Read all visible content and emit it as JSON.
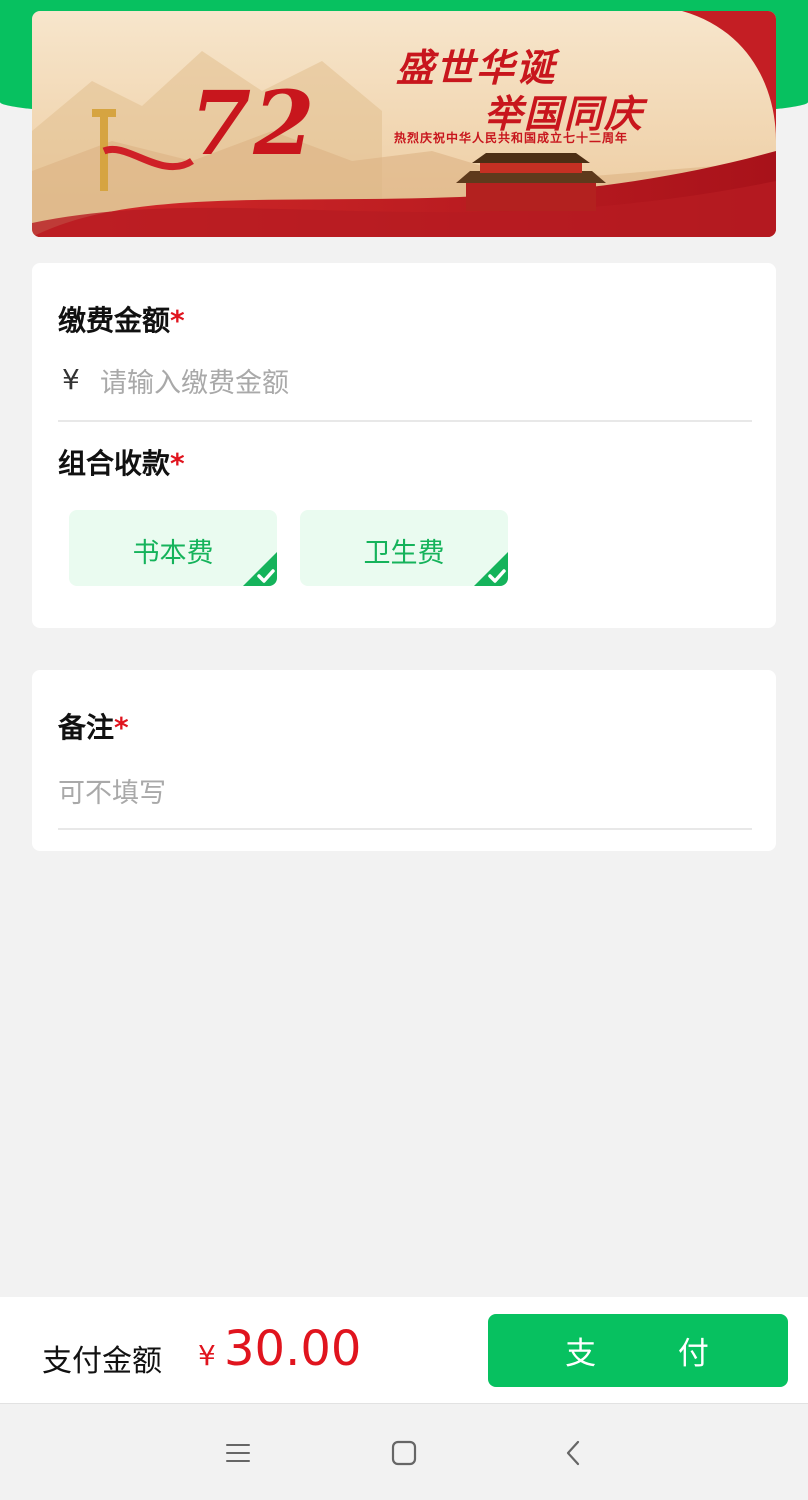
{
  "banner": {
    "line1": "盛世华诞",
    "line2": "举国同庆",
    "subtitle": "热烈庆祝中华人民共和国成立七十二周年",
    "number": "72"
  },
  "form": {
    "amount": {
      "label": "缴费金额",
      "required_mark": "*",
      "currency_symbol": "¥",
      "placeholder": "请输入缴费金额",
      "value": ""
    },
    "combo": {
      "label": "组合收款",
      "required_mark": "*",
      "options": [
        {
          "label": "书本费",
          "selected": true
        },
        {
          "label": "卫生费",
          "selected": true
        }
      ]
    },
    "remark": {
      "label": "备注",
      "required_mark": "*",
      "placeholder": "可不填写",
      "value": ""
    }
  },
  "footer": {
    "pay_label": "支付金额",
    "currency_symbol": "¥",
    "amount": "30.00",
    "pay_button_chars": [
      "支",
      "付"
    ]
  },
  "colors": {
    "accent_green": "#07c160",
    "chip_text": "#15b35b",
    "price_red": "#e0141e",
    "banner_red": "#c8161d"
  },
  "icons": [
    "checkmark-corner-icon",
    "menu-icon",
    "home-square-icon",
    "back-chevron-icon"
  ]
}
